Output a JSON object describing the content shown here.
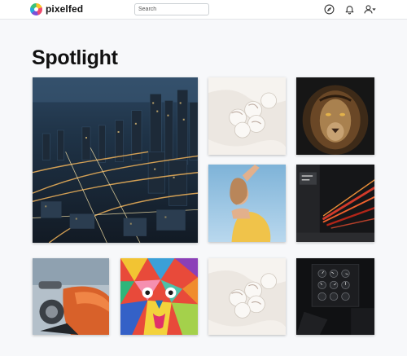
{
  "app": {
    "brand": "pixelfed"
  },
  "header": {
    "search_placeholder": "Search",
    "icons": [
      "compass-icon",
      "bell-icon",
      "user-icon",
      "caret-down-icon"
    ]
  },
  "page": {
    "title": "Spotlight"
  },
  "colors": {
    "accent_bg": "#f7f8fa",
    "navbar_bg": "#ffffff"
  },
  "gallery": {
    "items": [
      "city-night-aerial-photo",
      "cotton-flowers-photo",
      "lion-portrait-photo",
      "woman-sky-photo",
      "subway-light-trails-photo",
      "orange-motorcycle-photo",
      "graffiti-face-mural-photo",
      "cotton-flowers-photo",
      "cockpit-gauges-photo"
    ]
  }
}
